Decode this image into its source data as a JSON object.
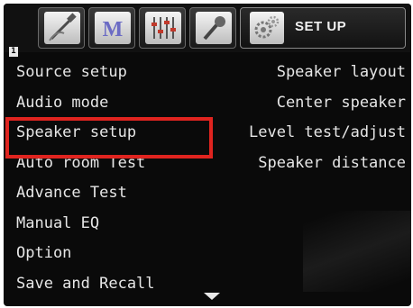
{
  "tabs": [
    {
      "id": "tab-connections",
      "icon": "cable-icon"
    },
    {
      "id": "tab-music",
      "icon": "m-logo-icon"
    },
    {
      "id": "tab-equalizer",
      "icon": "equalizer-sliders-icon"
    },
    {
      "id": "tab-microphone",
      "icon": "microphone-icon"
    },
    {
      "id": "tab-setup",
      "icon": "gears-icon",
      "label": "SET UP",
      "active": true
    }
  ],
  "page_badge": "1",
  "menu": {
    "left": [
      "Source setup",
      "Audio mode",
      "Speaker setup",
      "Auto room Test",
      "Advance Test",
      "Manual EQ",
      "Option",
      "Save and Recall"
    ],
    "right": [
      "Speaker layout",
      "Center speaker",
      "Level test/adjust",
      "Speaker distance"
    ],
    "selected": "Speaker setup"
  },
  "colors": {
    "highlight": "#e0241f",
    "text": "#e6e6e6",
    "background": "#0a0a0a"
  }
}
